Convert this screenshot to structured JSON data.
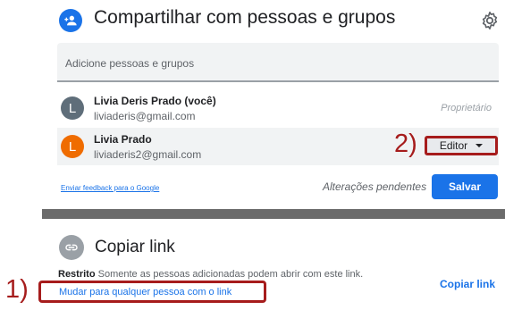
{
  "share": {
    "title": "Compartilhar com pessoas e grupos",
    "input_placeholder": "Adicione pessoas e grupos",
    "people": [
      {
        "avatar_letter": "L",
        "name": "Livia Deris Prado (você)",
        "email": "liviaderis@gmail.com",
        "role": "Proprietário",
        "avatar_color": "#5f6e7a"
      },
      {
        "avatar_letter": "L",
        "name": "Livia Prado",
        "email": "liviaderis2@gmail.com",
        "role": "Editor",
        "avatar_color": "#ef6c00"
      }
    ],
    "feedback_link": "Enviar feedback para o Google",
    "pending_text": "Alterações pendentes",
    "save_label": "Salvar"
  },
  "link": {
    "title": "Copiar link",
    "restrict_label": "Restrito",
    "restrict_desc": "Somente as pessoas adicionadas podem abrir com este link.",
    "change_link": "Mudar para qualquer pessoa com o link",
    "copy_link_label": "Copiar link"
  },
  "callouts": {
    "one": "1)",
    "two": "2)"
  },
  "colors": {
    "accent": "#1a73e8",
    "callout": "#a61c1c"
  },
  "icons": {
    "share": "person-add-icon",
    "settings": "gear-icon",
    "link": "link-icon",
    "dropdown": "caret-down-icon"
  }
}
